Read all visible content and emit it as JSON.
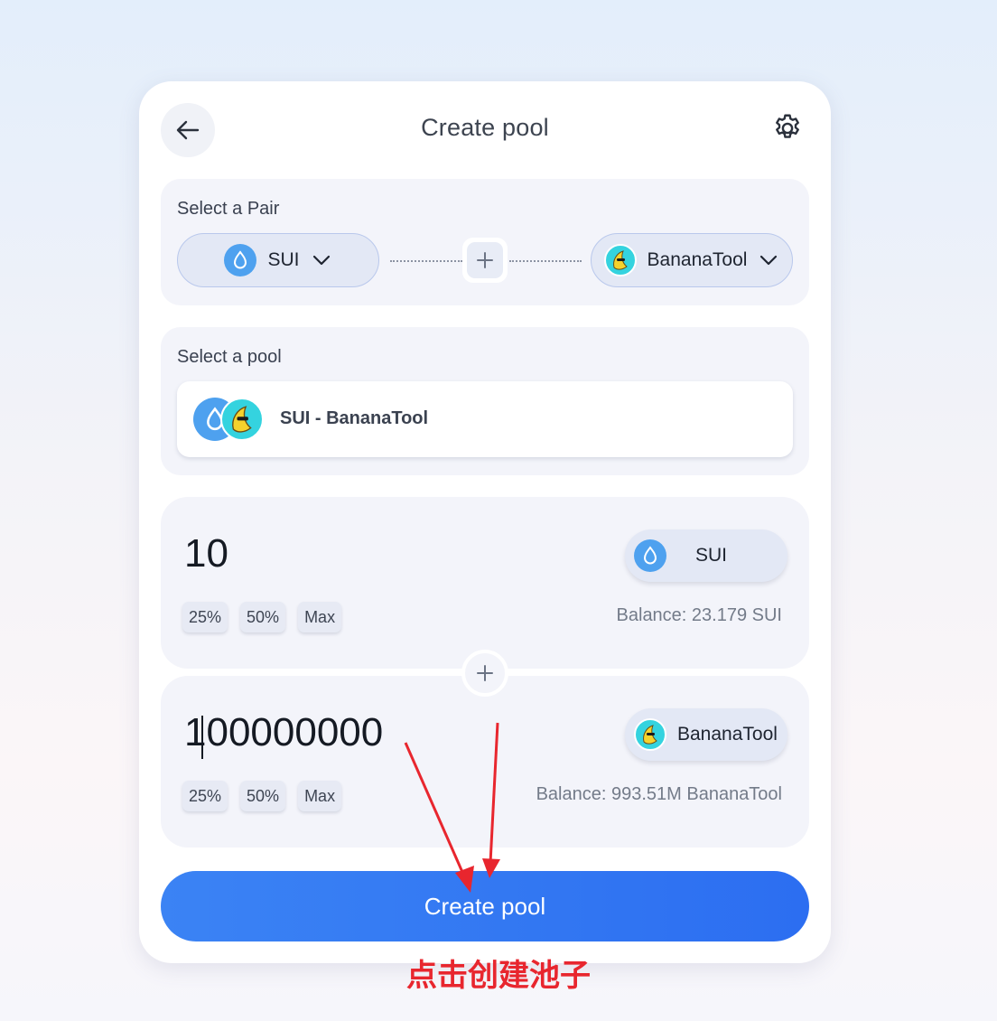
{
  "header": {
    "title": "Create pool"
  },
  "pair_section": {
    "label": "Select a Pair",
    "token_a": {
      "symbol": "SUI",
      "icon": "sui-logo-icon"
    },
    "token_b": {
      "symbol": "BananaTool",
      "icon": "bananatool-logo-icon"
    }
  },
  "pool_section": {
    "label": "Select a pool",
    "selected_pool": "SUI - BananaTool"
  },
  "input_a": {
    "amount": "10",
    "token": "SUI",
    "balance": "Balance: 23.179 SUI",
    "percent_buttons": [
      "25%",
      "50%",
      "Max"
    ]
  },
  "input_b": {
    "amount": "100000000",
    "token": "BananaTool",
    "balance": "Balance: 993.51M BananaTool",
    "percent_buttons": [
      "25%",
      "50%",
      "Max"
    ]
  },
  "action": {
    "create_label": "Create pool"
  },
  "annotation": {
    "text": "点击创建池子",
    "color": "#e8262e"
  },
  "colors": {
    "primary_button": "#2f74f3",
    "sui_blue": "#4ea1ef",
    "banana_cyan": "#34d3df"
  }
}
